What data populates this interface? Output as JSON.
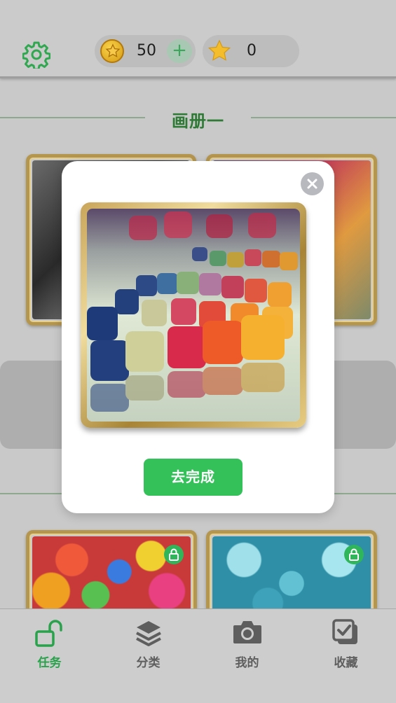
{
  "header": {
    "settings_icon": "gear-icon",
    "coins": {
      "value": "50",
      "icon": "coin-star-icon",
      "add_label": "+"
    },
    "stars": {
      "value": "0",
      "icon": "star-icon"
    }
  },
  "album": {
    "title": "画册一",
    "cards": [
      {
        "name": "puzzle-card-dark-candy",
        "locked": false
      },
      {
        "name": "puzzle-card-gummy",
        "locked": false
      },
      {
        "name": "puzzle-card-jelly-beans",
        "locked": true,
        "lock_icon": "lock-icon"
      },
      {
        "name": "puzzle-card-blue-gummies",
        "locked": true,
        "lock_icon": "lock-icon"
      }
    ]
  },
  "dialog": {
    "close_icon": "close-icon",
    "image": "rainbow-gummy-bears-image",
    "action_label": "去完成"
  },
  "colors": {
    "accent_green": "#34c15a",
    "title_green": "#2d7a35",
    "frame_gold": "#c9a55a",
    "nav_active": "#2aa24c",
    "nav_inactive": "#5e5e5e"
  },
  "bottom_nav": [
    {
      "label": "任务",
      "icon": "unlock-icon",
      "active": true
    },
    {
      "label": "分类",
      "icon": "layers-icon",
      "active": false
    },
    {
      "label": "我的",
      "icon": "camera-icon",
      "active": false
    },
    {
      "label": "收藏",
      "icon": "checkbox-icon",
      "active": false
    }
  ]
}
